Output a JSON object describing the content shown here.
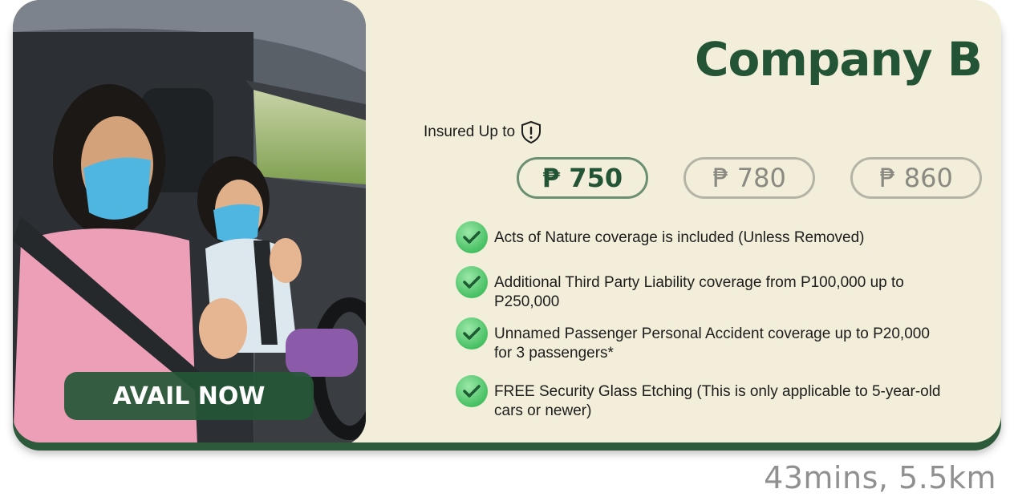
{
  "card": {
    "title": "Company B",
    "avail_label": "AVAIL NOW",
    "insured_label": "Insured Up to",
    "insured_icon": "shield-alert-icon",
    "prices": [
      {
        "label": "₱ 750",
        "selected": true
      },
      {
        "label": "₱ 780",
        "selected": false
      },
      {
        "label": "₱ 860",
        "selected": false
      }
    ],
    "features": [
      {
        "text": "Acts of Nature coverage is included (Unless Removed)",
        "icon": "check-icon"
      },
      {
        "text": "Additional Third Party Liability coverage from P100,000 up to P250,000",
        "icon": "check-icon"
      },
      {
        "text": "Unnamed Passenger Personal Accident coverage up to P20,000 for 3 passengers*",
        "icon": "check-icon"
      },
      {
        "text": "FREE Security Glass Etching (This is only applicable to 5-year-old cars or newer)",
        "icon": "check-icon"
      }
    ]
  },
  "eta": "43mins, 5.5km",
  "colors": {
    "card_bg": "#f2eed9",
    "brand_green": "#245436",
    "check_green": "#47c063",
    "muted_border": "#b4b4a6"
  }
}
